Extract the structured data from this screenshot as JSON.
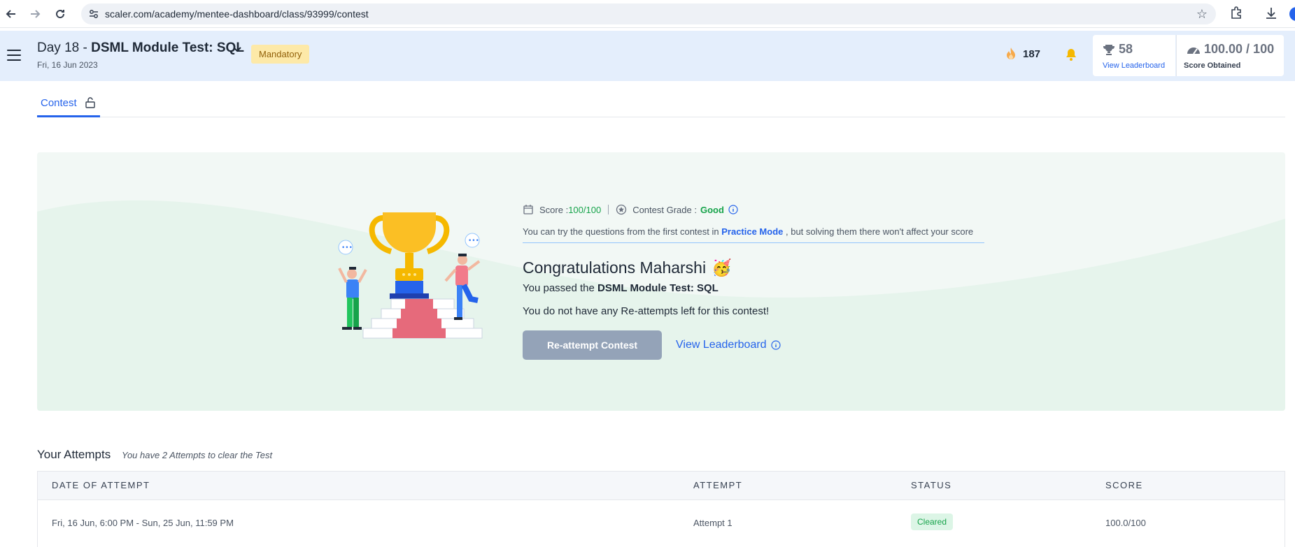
{
  "browser": {
    "url": "scaler.com/academy/mentee-dashboard/class/93999/contest",
    "icons": [
      "back-icon",
      "forward-icon",
      "reload-icon",
      "site-settings-icon",
      "star-icon",
      "extension-icon",
      "download-icon",
      "profile-avatar"
    ]
  },
  "header": {
    "day_prefix": "Day 18 - ",
    "title": "DSML Module Test: SQL",
    "date": "Fri, 16 Jun 2023",
    "mandatory_label": "Mandatory",
    "streak": "187",
    "rank_value": "58",
    "rank_link": "View Leaderboard",
    "score_value": "100.00 / 100",
    "score_label": "Score Obtained"
  },
  "tabs": [
    {
      "label": "Contest",
      "active": true
    }
  ],
  "hero": {
    "score_label": "Score : ",
    "score_value": "100/100",
    "grade_label": "Contest Grade : ",
    "grade_value": "Good",
    "practice_prefix": "You can try the questions from the first contest in ",
    "practice_link": "Practice Mode",
    "practice_suffix": " , but solving them there won't affect your score",
    "congrats": "Congratulations Maharshi",
    "congrats_emoji": "🥳",
    "passed_prefix": "You passed the ",
    "passed_title": "DSML Module Test: SQL",
    "no_reattempts": "You do not have any Re-attempts left for this contest!",
    "reattempt_button": "Re-attempt Contest",
    "leaderboard_link": "View Leaderboard"
  },
  "attempts": {
    "title": "Your Attempts",
    "note": "You have 2 Attempts to clear the Test",
    "columns": [
      "DATE OF ATTEMPT",
      "ATTEMPT",
      "STATUS",
      "SCORE"
    ],
    "rows": [
      {
        "date": "Fri, 16 Jun, 6:00 PM - Sun, 25 Jun, 11:59 PM",
        "attempt": "Attempt 1",
        "status": "Cleared",
        "score": "100.0/100"
      }
    ]
  },
  "colors": {
    "accent": "#2563eb",
    "header_bg": "#e4eefc",
    "hero_bg": "#f2f8f5",
    "success": "#16a34a",
    "mandatory_bg": "#fde9a8"
  }
}
